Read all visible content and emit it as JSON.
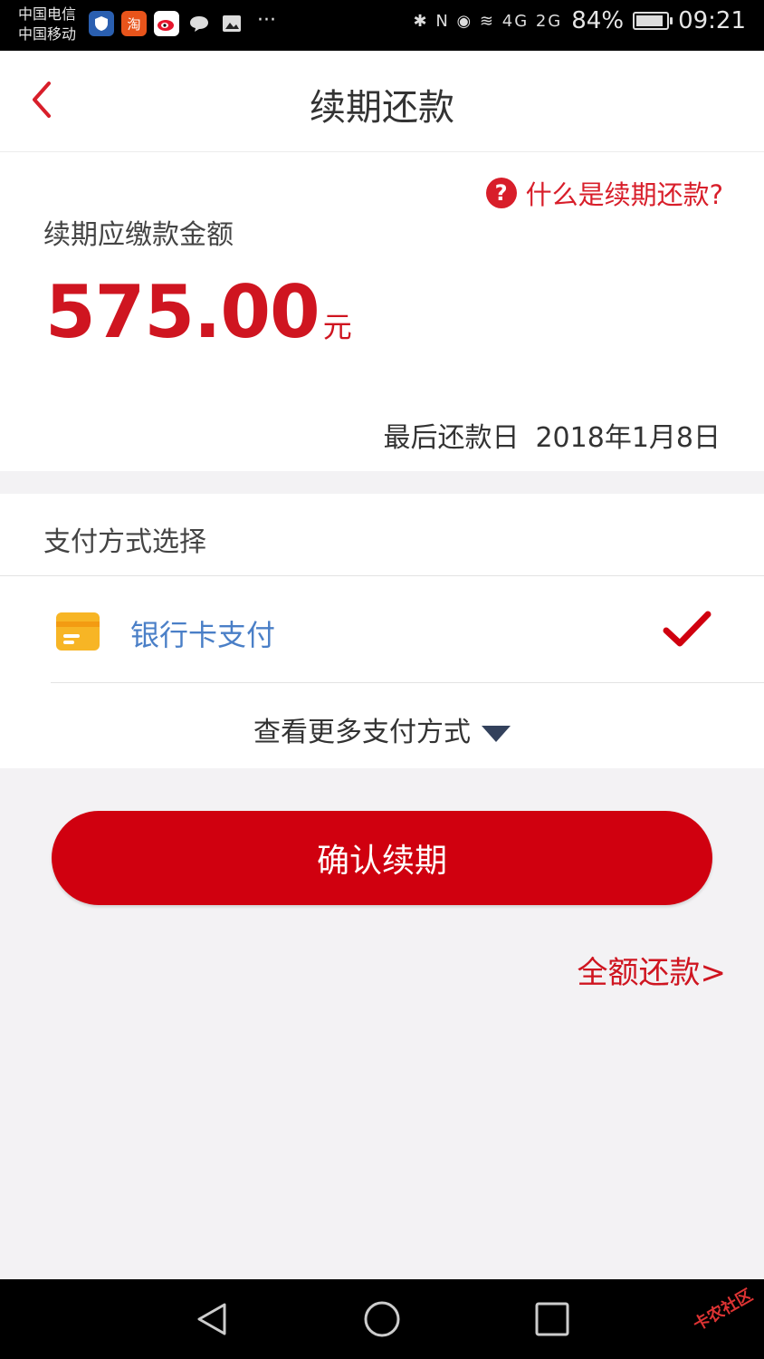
{
  "status_bar": {
    "carrier_1": "中国电信",
    "carrier_2": "中国移动",
    "taobao_glyph": "淘",
    "more_dots": "···",
    "system_icons": "✱ N ◉ ≋ 4G 2G",
    "battery": "84%",
    "time": "09:21"
  },
  "nav": {
    "title": "续期还款",
    "back_icon": "chevron-left-icon"
  },
  "summary": {
    "help_link": "什么是续期还款?",
    "help_glyph": "?",
    "amount_label": "续期应缴款金额",
    "amount": "575.00",
    "currency": "元",
    "due_label": "最后还款日",
    "due_date": "2018年1月8日"
  },
  "payment": {
    "header": "支付方式选择",
    "method_label": "银行卡支付",
    "more_label": "查看更多支付方式"
  },
  "actions": {
    "confirm_label": "确认续期",
    "full_pay_label": "全额还款>"
  },
  "watermark": "卡农社区",
  "colors": {
    "accent": "#d0000f",
    "link_blue": "#4a7fc7",
    "card_yellow": "#f7b525",
    "page_bg": "#f3f2f4"
  }
}
